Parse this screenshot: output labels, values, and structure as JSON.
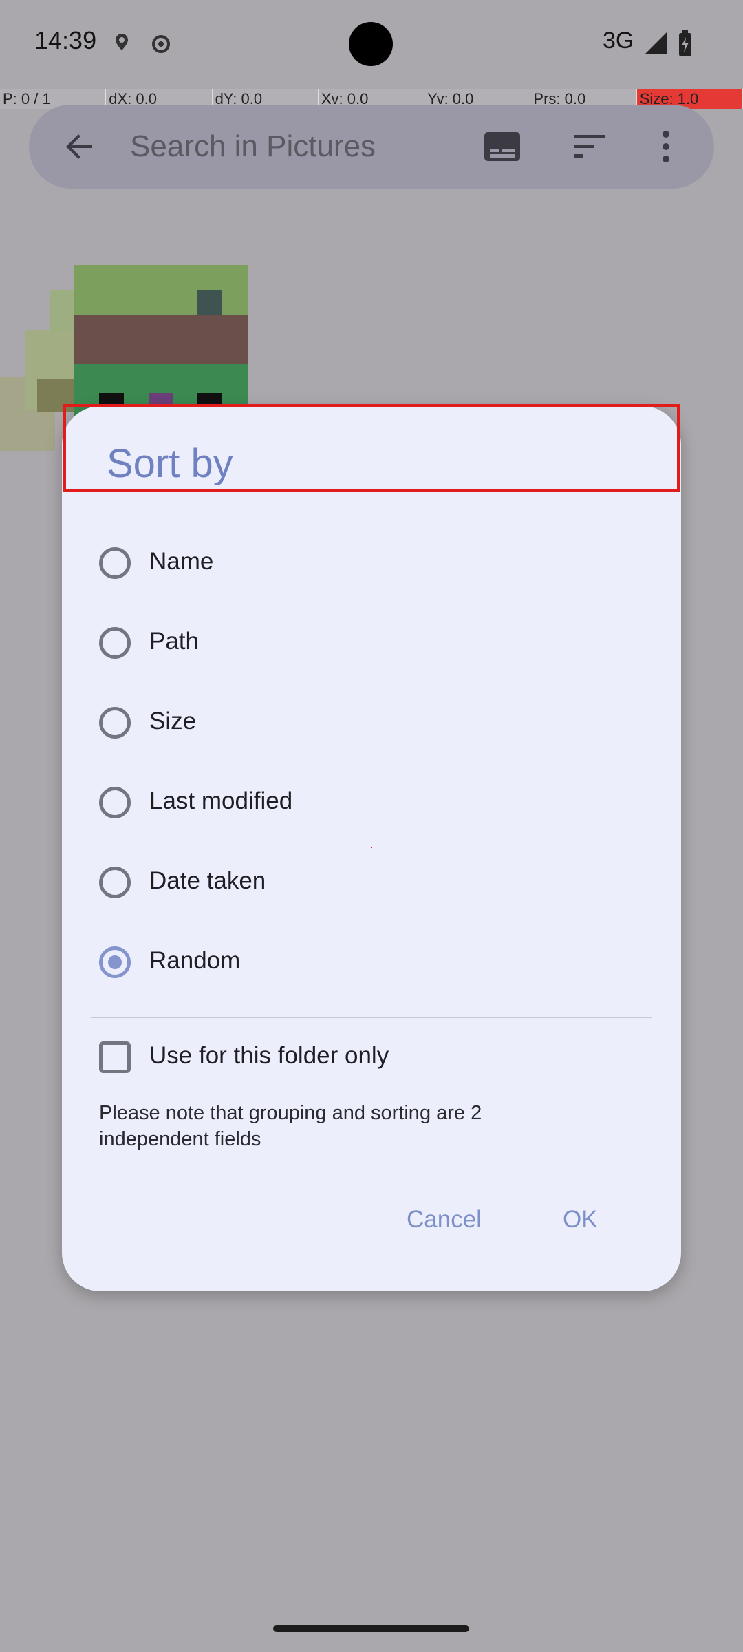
{
  "status_bar": {
    "time": "14:39",
    "network": "3G"
  },
  "debug_bar": [
    "P: 0 / 1",
    "dX: 0.0",
    "dY: 0.0",
    "Xv: 0.0",
    "Yv: 0.0",
    "Prs: 0.0",
    "Size: 1.0"
  ],
  "search": {
    "placeholder": "Search in Pictures"
  },
  "dialog": {
    "title": "Sort by",
    "options": [
      {
        "label": "Name",
        "checked": false
      },
      {
        "label": "Path",
        "checked": false
      },
      {
        "label": "Size",
        "checked": false
      },
      {
        "label": "Last modified",
        "checked": false
      },
      {
        "label": "Date taken",
        "checked": false
      },
      {
        "label": "Random",
        "checked": true
      }
    ],
    "folder_only_label": "Use for this folder only",
    "folder_only_checked": false,
    "note": "Please note that grouping and sorting are 2 independent fields",
    "cancel_label": "Cancel",
    "ok_label": "OK"
  },
  "colors": {
    "accent": "#8494cc",
    "dialog_bg": "#eceefb",
    "scrim": "#aaa8ac",
    "highlight": "#e21b1b"
  }
}
